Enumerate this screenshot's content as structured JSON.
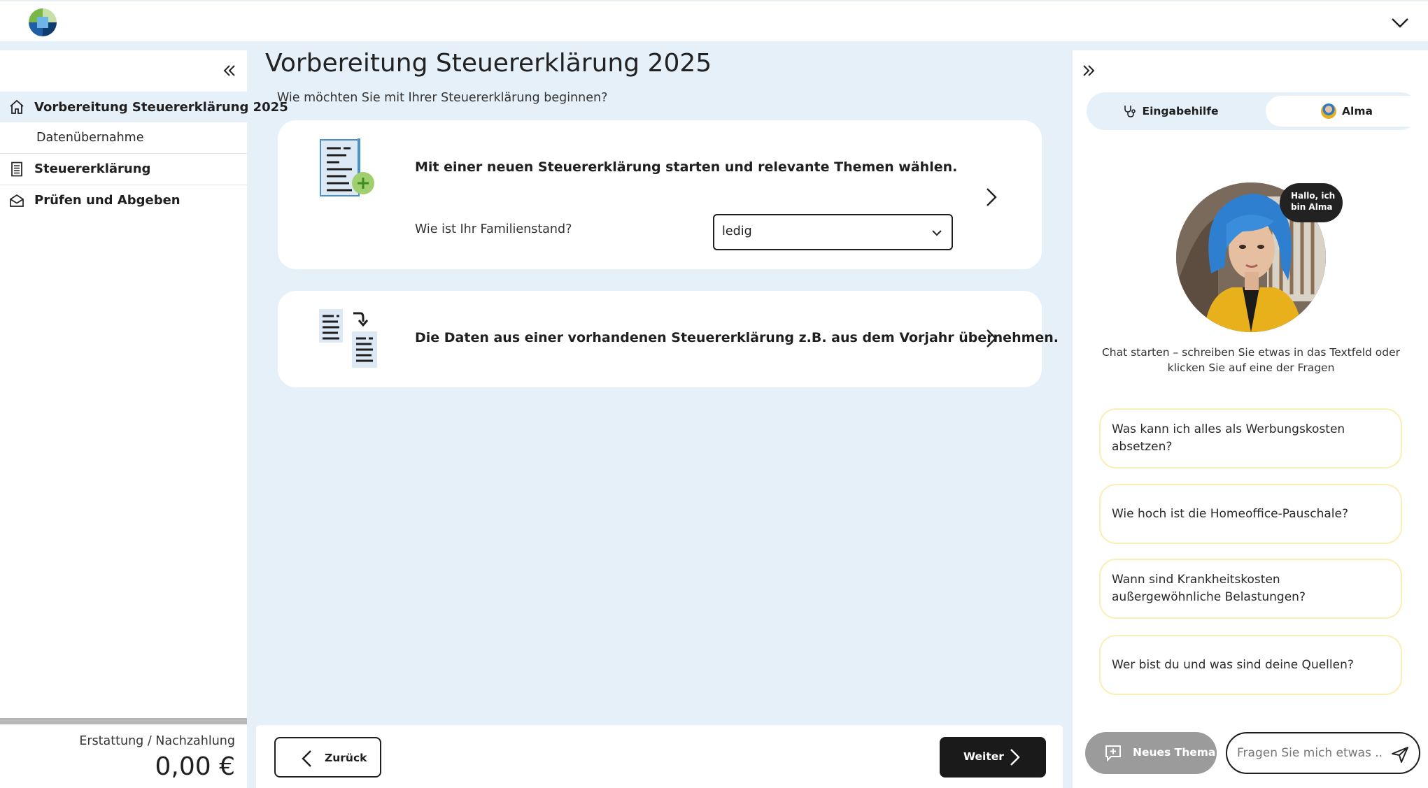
{
  "header": {
    "logo_icon": "logo-icon",
    "menu_icon": "chevron-down-icon"
  },
  "sidebar": {
    "collapse_icon": "double-chevron-left-icon",
    "items": [
      {
        "label": "Vorbereitung Steuererklärung 2025",
        "icon": "home-icon",
        "active": true
      },
      {
        "label": "Datenübernahme",
        "sub": true
      },
      {
        "label": "Steuererklärung",
        "icon": "document-icon"
      },
      {
        "label": "Prüfen und Abgeben",
        "icon": "envelope-icon"
      }
    ],
    "refund_label": "Erstattung / Nachzahlung",
    "refund_value": "0,00 €"
  },
  "main": {
    "title": "Vorbereitung Steuererklärung 2025",
    "subtitle": "Wie möchten Sie mit Ihrer Steuererklärung beginnen?",
    "option_new": {
      "title": "Mit einer neuen Steuererklärung starten und relevante Themen wählen.",
      "field_label": "Wie ist Ihr Familienstand?",
      "field_value": "ledig"
    },
    "option_import": {
      "title": "Die Daten aus einer vorhandenen Steuererklärung z.B. aus dem Vorjahr übernehmen."
    }
  },
  "footer": {
    "back_label": "Zurück",
    "next_label": "Weiter"
  },
  "assistant": {
    "tab_help": "Eingabehilfe",
    "tab_alma": "Alma",
    "bubble": "Hallo, ich bin Alma",
    "intro": "Chat starten – schreiben Sie etwas in das Textfeld oder klicken Sie auf eine der Fragen",
    "questions": [
      "Was kann ich alles als Werbungskosten absetzen?",
      "Wie hoch ist die Homeoffice-Pauschale?",
      "Wann sind Krankheitskosten außergewöhnliche Belastungen?",
      "Wer bist du und was sind deine Quellen?"
    ],
    "new_topic": "Neues Thema",
    "input_placeholder": "Fragen Sie mich etwas ..."
  },
  "colors": {
    "accent": "#1a1a1a",
    "page_bg": "#e6f0f8",
    "question_border": "#fbefb8",
    "logo_green": "#7ab648",
    "logo_blue": "#1f5fa6"
  }
}
